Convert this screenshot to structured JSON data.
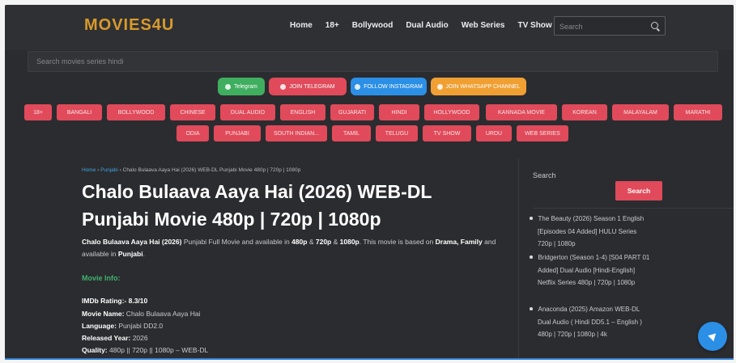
{
  "header": {
    "logo": "MOVIES4U",
    "nav": [
      "Home",
      "18+",
      "Bollywood",
      "Dual Audio",
      "Web Series",
      "TV Show"
    ],
    "search_placeholder": "Search"
  },
  "main_search_placeholder": "Search movies series hindi",
  "social": [
    {
      "label": "Telegram",
      "color": "#3fae5f"
    },
    {
      "label": "JOIN TELEGRAM",
      "color": "#e04a5a"
    },
    {
      "label": "FOLLOW INSTAGRAM",
      "color": "#2b8fe6"
    },
    {
      "label": "JOIN WHATSAPP CHANNEL",
      "color": "#f0a033"
    }
  ],
  "categories_row1": [
    "18+",
    "BANGALI",
    "BOLLYWOOD",
    "CHINESE",
    "DUAL AUDIO",
    "ENGLISH",
    "GUJARATI",
    "HINDI",
    "HOLLYWOOD",
    "KANNADA MOVIE",
    "KOREAN",
    "MALAYALAM",
    "MARATHI"
  ],
  "categories_row2": [
    "ODIA",
    "PUNJABI",
    "SOUTH INDIAN...",
    "TAMIL",
    "TELUGU",
    "TV SHOW",
    "URDU",
    "WEB SERIES"
  ],
  "breadcrumb": {
    "home": "Home",
    "category": "Punjabi",
    "current": "Chalo Bulaava Aaya Hai (2026) WEB-DL Punjabi Movie 480p | 720p | 1080p"
  },
  "title": "Chalo Bulaava Aaya Hai (2026) WEB-DL Punjabi Movie 480p | 720p | 1080p",
  "description": {
    "name": "Chalo Bulaava Aaya Hai (2026)",
    "t1": " Punjabi Full Movie and available in ",
    "q1": "480p",
    "t2": " & ",
    "q2": "720p",
    "t3": " & ",
    "q3": "1080p",
    "t4": ". This movie is based on ",
    "genres": "Drama, Family",
    "t5": " and available in ",
    "lang": "Punjabi",
    "t6": "."
  },
  "movie_info": {
    "heading": "Movie Info:",
    "rows": [
      {
        "label": "IMDb Rating:-",
        "value": " 8.3/10",
        "bold": true
      },
      {
        "label": "Movie Name:",
        "value": " Chalo Bulaava Aaya Hai"
      },
      {
        "label": "Language:",
        "value": " Punjabi DD2.0"
      },
      {
        "label": "Released Year:",
        "value": " 2026"
      },
      {
        "label": "Quality:",
        "value": " 480p || 720p || 1080p – WEB-DL"
      }
    ]
  },
  "sidebar": {
    "search_label": "Search",
    "search_button": "Search",
    "posts": [
      "The Beauty (2026) Season 1 English [Episodes 04 Added] HULU Series 720p | 1080p",
      "Bridgerton (Season 1-4) [S04 PART 01 Added] Dual Audio [Hindi-English] Netflix Series 480p | 720p | 1080p",
      "Anaconda (2025) Amazon WEB-DL Dual Audio ( Hindi DD5.1 – English ) 480p | 720p | 1080p | 4k"
    ]
  }
}
